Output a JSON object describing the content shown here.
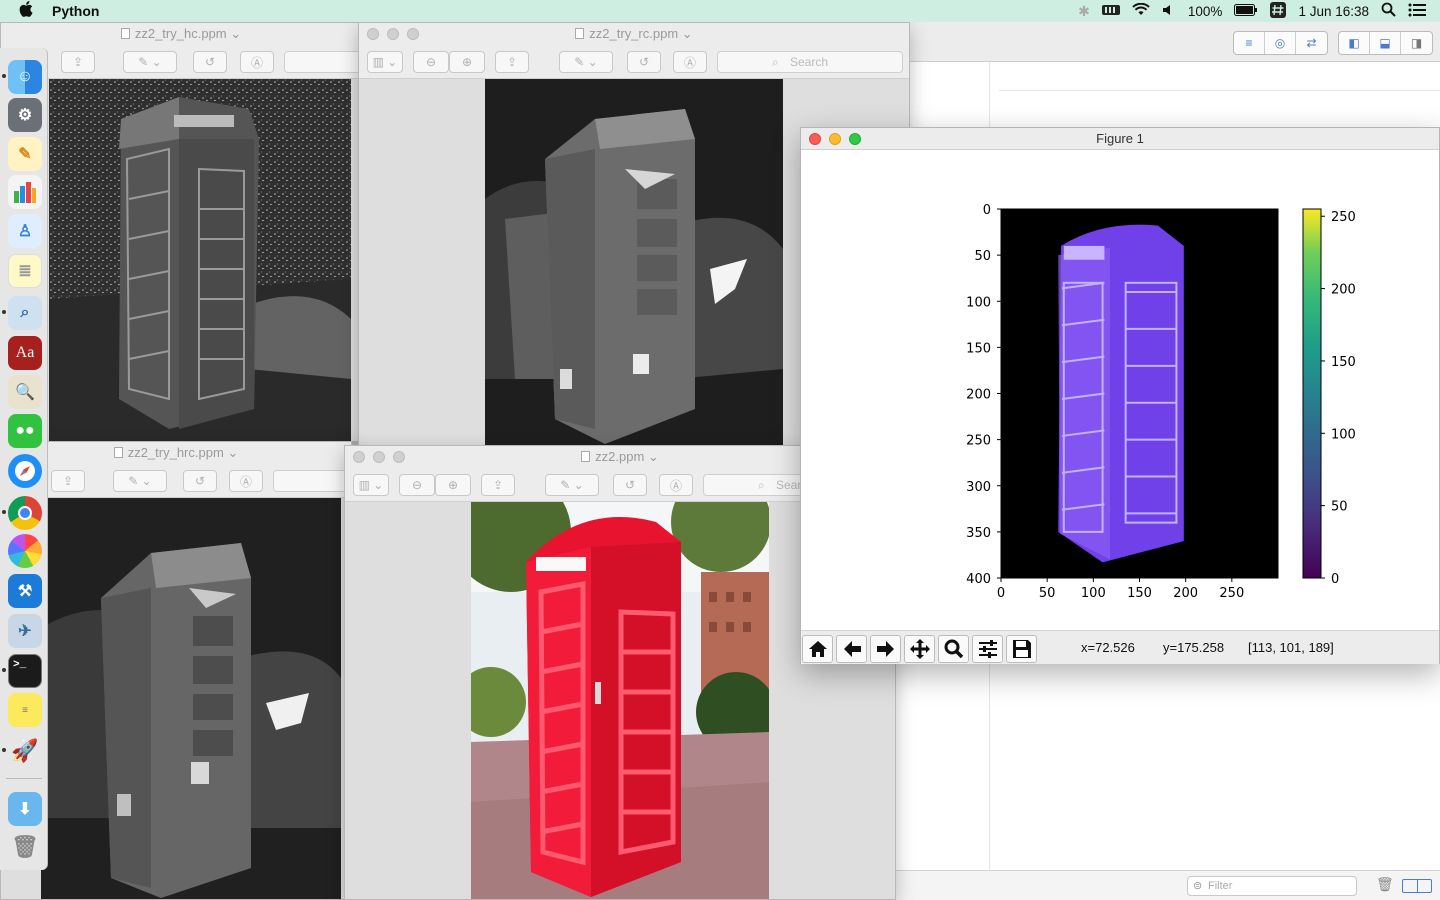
{
  "menubar": {
    "apple": "",
    "app_name": "Python",
    "battery": "100%",
    "date_time": "1 Jun  16:38"
  },
  "windows": {
    "hc": {
      "title": "zz2_try_hc.ppm"
    },
    "rc": {
      "title": "zz2_try_rc.ppm",
      "search_placeholder": "Search"
    },
    "hrc": {
      "title": "zz2_try_hrc.ppm"
    },
    "orig": {
      "title": "zz2.ppm",
      "search_placeholder": "Search"
    }
  },
  "background_app": {
    "filter_placeholder": "Filter"
  },
  "figure": {
    "title": "Figure 1",
    "status": {
      "x": "x=72.526",
      "y": "y=175.258",
      "pixel": "[113, 101, 189]"
    },
    "toolbar_buttons": [
      "home-icon",
      "back-icon",
      "forward-icon",
      "pan-icon",
      "zoom-icon",
      "configure-icon",
      "save-icon"
    ]
  },
  "chart_data": {
    "type": "heatmap",
    "title": "",
    "xlabel": "",
    "ylabel": "",
    "xlim": [
      0,
      300
    ],
    "ylim": [
      400,
      0
    ],
    "x_ticks": [
      0,
      50,
      100,
      150,
      200,
      250
    ],
    "y_ticks": [
      0,
      50,
      100,
      150,
      200,
      250,
      300,
      350,
      400
    ],
    "colorbar": {
      "colormap": "viridis",
      "range": [
        0,
        255
      ],
      "ticks": [
        0,
        50,
        100,
        150,
        200,
        250
      ]
    },
    "image_colors": {
      "background": "#000000",
      "subject": "#7040e8"
    }
  }
}
